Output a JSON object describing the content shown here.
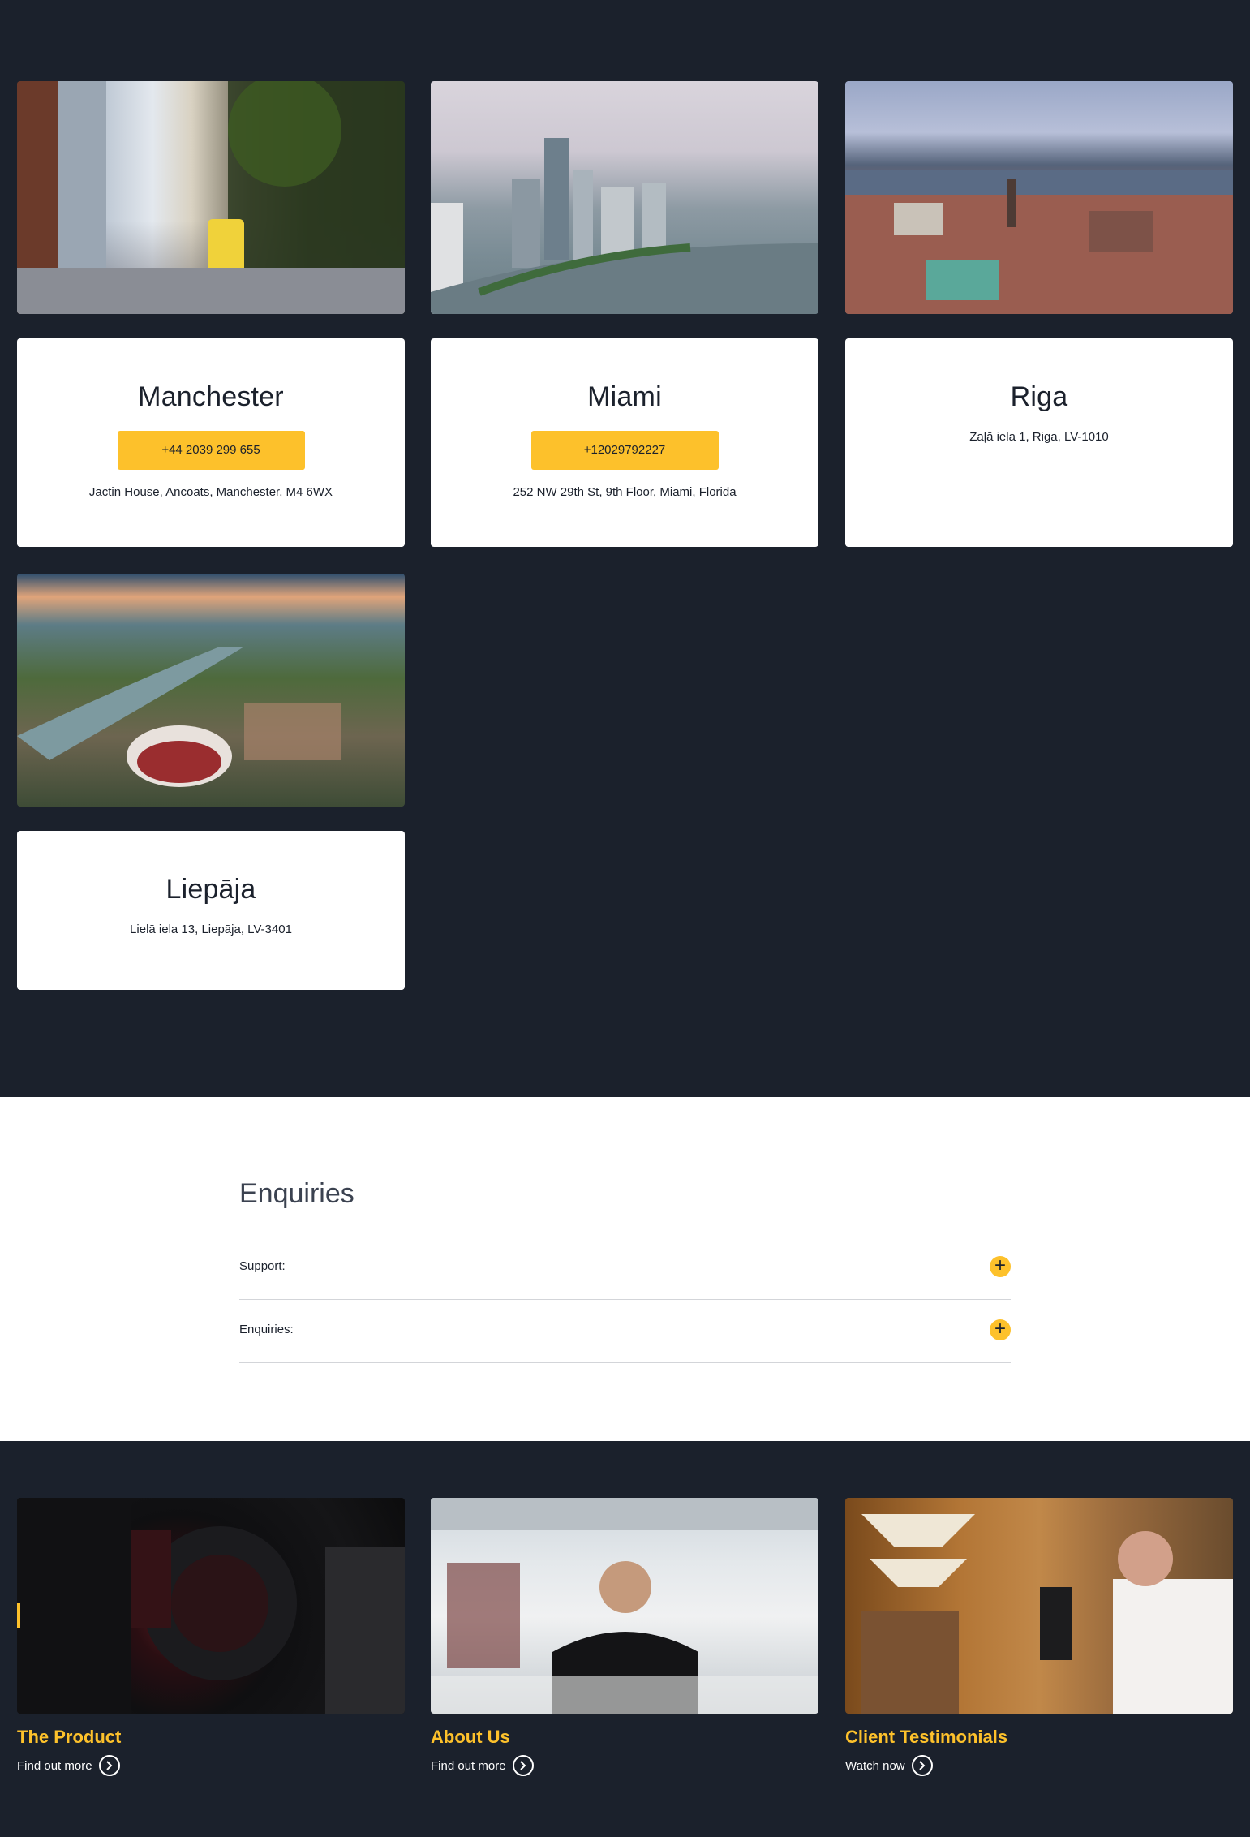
{
  "locations": [
    {
      "city": "Manchester",
      "phone": "+44 2039 299 655",
      "address": "Jactin House, Ancoats, Manchester, M4 6WX",
      "photo_icon": "manchester-street-photo"
    },
    {
      "city": "Miami",
      "phone": "+12029792227",
      "address": "252 NW 29th St, 9th Floor, Miami, Florida",
      "photo_icon": "miami-skyline-photo"
    },
    {
      "city": "Riga",
      "phone": "",
      "address": "Zaļā iela 1, Riga, LV-1010",
      "photo_icon": "riga-aerial-photo"
    },
    {
      "city": "Liepāja",
      "phone": "",
      "address": "Lielā iela 13, Liepāja, LV-3401",
      "photo_icon": "liepaja-aerial-photo"
    }
  ],
  "enquiries": {
    "title": "Enquiries",
    "items": [
      {
        "label": "Support:"
      },
      {
        "label": "Enquiries:"
      }
    ]
  },
  "tiles": [
    {
      "title": "The Product",
      "link": "Find out more"
    },
    {
      "title": "About Us",
      "link": "Find out more"
    },
    {
      "title": "Client Testimonials",
      "link": "Watch now"
    }
  ],
  "colors": {
    "background": "#1b212c",
    "accent": "#fdc12b",
    "card": "#ffffff"
  }
}
